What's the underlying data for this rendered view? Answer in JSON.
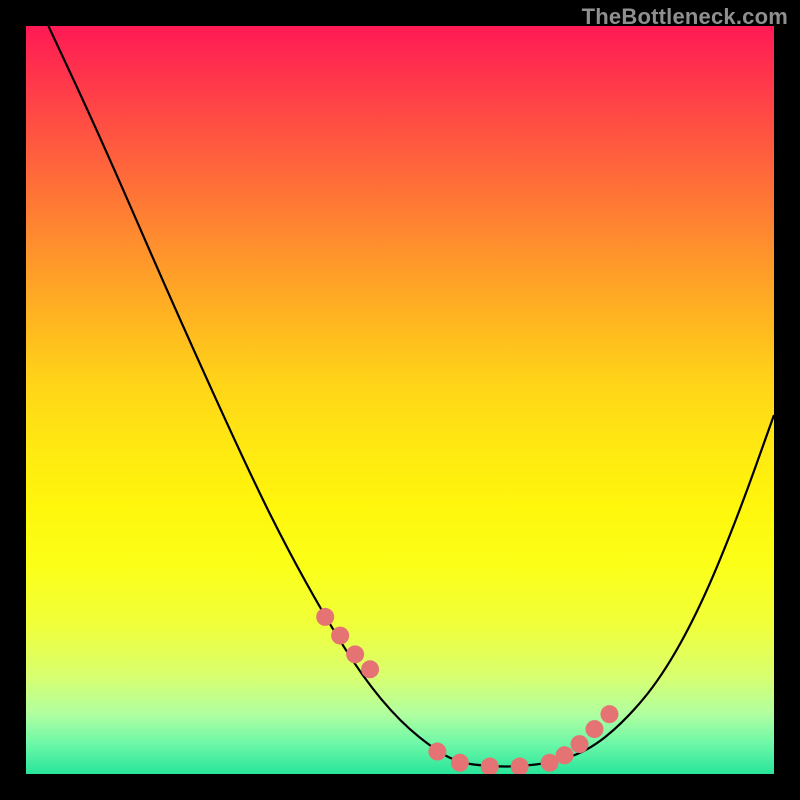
{
  "watermark": "TheBottleneck.com",
  "chart_data": {
    "type": "line",
    "title": "",
    "xlabel": "",
    "ylabel": "",
    "xlim": [
      0,
      100
    ],
    "ylim": [
      0,
      100
    ],
    "series": [
      {
        "name": "curve",
        "x": [
          3,
          10,
          20,
          30,
          35,
          40,
          45,
          50,
          55,
          58,
          62,
          66,
          70,
          75,
          80,
          85,
          90,
          95,
          100
        ],
        "y": [
          100,
          85,
          62,
          40,
          30,
          21,
          13,
          7,
          3,
          1.5,
          1,
          1,
          1.5,
          3,
          7,
          13,
          22,
          34,
          48
        ]
      }
    ],
    "markers": {
      "name": "highlight-dots",
      "color": "#e57373",
      "radius_px": 9,
      "x": [
        40,
        42,
        44,
        46,
        55,
        58,
        62,
        66,
        70,
        72,
        74,
        76,
        78
      ],
      "y": [
        21,
        18.5,
        16,
        14,
        3,
        1.5,
        1,
        1,
        1.5,
        2.5,
        4,
        6,
        8
      ]
    },
    "background": "vertical_gradient_red_to_green",
    "notes": "No axis ticks or numeric labels are rendered in the image; x/y values are normalized 0-100 estimates read from the plot area."
  }
}
